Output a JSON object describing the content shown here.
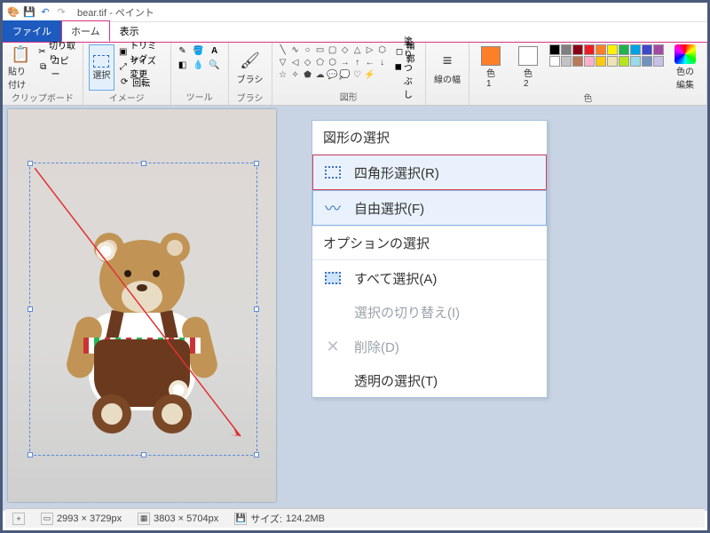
{
  "title": "bear.tif - ペイント",
  "tabs": {
    "file": "ファイル",
    "home": "ホーム",
    "view": "表示"
  },
  "ribbon": {
    "clipboard": {
      "label": "クリップボード",
      "paste": "貼り付け",
      "cut": "切り取り",
      "copy": "コピー"
    },
    "image": {
      "label": "イメージ",
      "select": "選択",
      "crop": "トリミング",
      "resize": "サイズ変更",
      "rotate": "回転"
    },
    "tools": {
      "label": "ツール"
    },
    "brushes": {
      "label": "ブラシ"
    },
    "shapes": {
      "label": "図形",
      "outline": "輪郭",
      "fill": "塗りつぶし"
    },
    "thickness": {
      "label": "線の幅"
    },
    "colors": {
      "label": "色",
      "c1": "色\n1",
      "c2": "色\n2",
      "edit": "色の\n編集"
    }
  },
  "menu": {
    "header1": "図形の選択",
    "rect": "四角形選択(R)",
    "free": "自由選択(F)",
    "header2": "オプションの選択",
    "all": "すべて選択(A)",
    "invert": "選択の切り替え(I)",
    "delete": "削除(D)",
    "transparent": "透明の選択(T)"
  },
  "status": {
    "sel_dims": "2993 × 3729px",
    "img_dims": "3803 × 5704px",
    "size_label": "サイズ:",
    "size_val": "124.2MB"
  },
  "palette_colors": [
    "#000",
    "#7f7f7f",
    "#880015",
    "#ed1c24",
    "#ff7f27",
    "#fff200",
    "#22b14c",
    "#00a2e8",
    "#3f48cc",
    "#a349a4",
    "#fff",
    "#c3c3c3",
    "#b97a57",
    "#ffafc9",
    "#ffc90e",
    "#efe4b0",
    "#b5e61d",
    "#99d9ea",
    "#7092be",
    "#c8bfe7"
  ],
  "current_color1": "#ff7f27",
  "current_color2": "#ffffff"
}
